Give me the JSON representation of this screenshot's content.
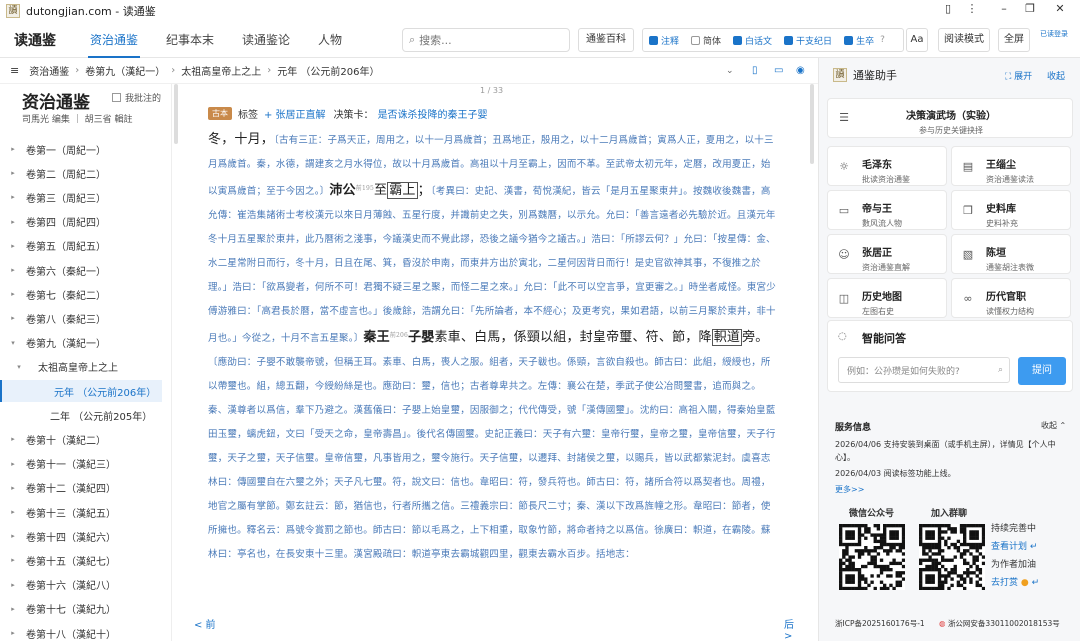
{
  "titlebar": {
    "title": "dutongjian.com - 读通鉴"
  },
  "nav": {
    "brand": "读通鉴",
    "tabs": [
      "资治通鉴",
      "纪事本末",
      "读通鉴论",
      "人物"
    ],
    "active": 0,
    "search_placeholder": "搜索...",
    "baike": "通鉴百科",
    "toggles": [
      {
        "label": "注释",
        "on": true
      },
      {
        "label": "简体",
        "on": false
      },
      {
        "label": "白话文",
        "on": true
      },
      {
        "label": "干支纪日",
        "on": true
      },
      {
        "label": "生卒",
        "on": true
      }
    ],
    "toggle_help": "?",
    "font_btn": "Aa",
    "read_mode": "阅读模式",
    "fullscreen": "全屏",
    "login": "已读登录"
  },
  "breadcrumb": [
    "资治通鉴",
    "卷第九（漢紀一）",
    "太祖高皇帝上之上",
    "元年 （公元前206年）"
  ],
  "left": {
    "title": "资治通鉴",
    "annotated_label": "我批注的",
    "authors": "司馬光  编集 ｜ 胡三省  輯註",
    "volumes": [
      {
        "label": "卷第一（周紀一）",
        "kind": "vol"
      },
      {
        "label": "卷第二（周紀二）",
        "kind": "vol"
      },
      {
        "label": "卷第三（周紀三）",
        "kind": "vol"
      },
      {
        "label": "卷第四（周紀四）",
        "kind": "vol"
      },
      {
        "label": "卷第五（周紀五）",
        "kind": "vol"
      },
      {
        "label": "卷第六（秦紀一）",
        "kind": "vol"
      },
      {
        "label": "卷第七（秦紀二）",
        "kind": "vol"
      },
      {
        "label": "卷第八（秦紀三）",
        "kind": "vol"
      },
      {
        "label": "卷第九（漢紀一）",
        "kind": "open"
      },
      {
        "label": "太祖高皇帝上之上",
        "kind": "sub"
      },
      {
        "label": "元年 （公元前206年）",
        "kind": "active"
      },
      {
        "label": "二年 （公元前205年）",
        "kind": "year"
      },
      {
        "label": "卷第十（漢紀二）",
        "kind": "vol"
      },
      {
        "label": "卷第十一（漢紀三）",
        "kind": "vol"
      },
      {
        "label": "卷第十二（漢紀四）",
        "kind": "vol"
      },
      {
        "label": "卷第十三（漢紀五）",
        "kind": "vol"
      },
      {
        "label": "卷第十四（漢紀六）",
        "kind": "vol"
      },
      {
        "label": "卷第十五（漢紀七）",
        "kind": "vol"
      },
      {
        "label": "卷第十六（漢紀八）",
        "kind": "vol"
      },
      {
        "label": "卷第十七（漢紀九）",
        "kind": "vol"
      },
      {
        "label": "卷第十八（漢紀十）",
        "kind": "vol"
      }
    ]
  },
  "reader": {
    "page": "1 / 33",
    "tag_old": "古本",
    "tags_label": "标签",
    "add_tag": "+ 张居正直解",
    "decision_label": "决策卡：",
    "decision_link": "是否诛杀投降的秦王子婴",
    "prev": "< 前",
    "next": "后 >"
  },
  "assistant": {
    "title": "通鉴助手",
    "expand": "展开",
    "collapse": "收起",
    "feature": {
      "title": "决策演武场（实验）",
      "sub": "参与历史关键抉择"
    },
    "cards": [
      {
        "title": "毛泽东",
        "sub": "批读资治通鉴",
        "icon": "sun-icon"
      },
      {
        "title": "王缁尘",
        "sub": "资治通鉴读法",
        "icon": "doc-icon"
      },
      {
        "title": "帝与王",
        "sub": "數风流人物",
        "icon": "card-icon"
      },
      {
        "title": "史料库",
        "sub": "史料补充",
        "icon": "book-icon"
      },
      {
        "title": "张居正",
        "sub": "资治通鉴直解",
        "icon": "person-icon"
      },
      {
        "title": "陈垣",
        "sub": "通鉴胡注表微",
        "icon": "file-icon"
      },
      {
        "title": "历史地图",
        "sub": "左图右史",
        "icon": "map-icon"
      },
      {
        "title": "历代官职",
        "sub": "读懂权力结构",
        "icon": "chain-icon"
      }
    ],
    "qa_title": "智能问答",
    "qa_placeholder": "例如：公孙瓒是如何失败的?",
    "qa_submit": "提问",
    "service_title": "服务信息",
    "service_toggle": "收起",
    "news": [
      "2026/04/06  支持安装到桌面（或手机主屏），详情见【个人中心】。",
      "2026/04/03  阅读标签功能上线。"
    ],
    "more": "更多>>",
    "wechat": "微信公众号",
    "group": "加入群聊",
    "support": [
      "持续完善中",
      "查看计划",
      "为作者加油",
      "去打赏"
    ],
    "icp": "浙ICP备2025160176号-1",
    "police": "浙公网安备33011002018153号"
  }
}
